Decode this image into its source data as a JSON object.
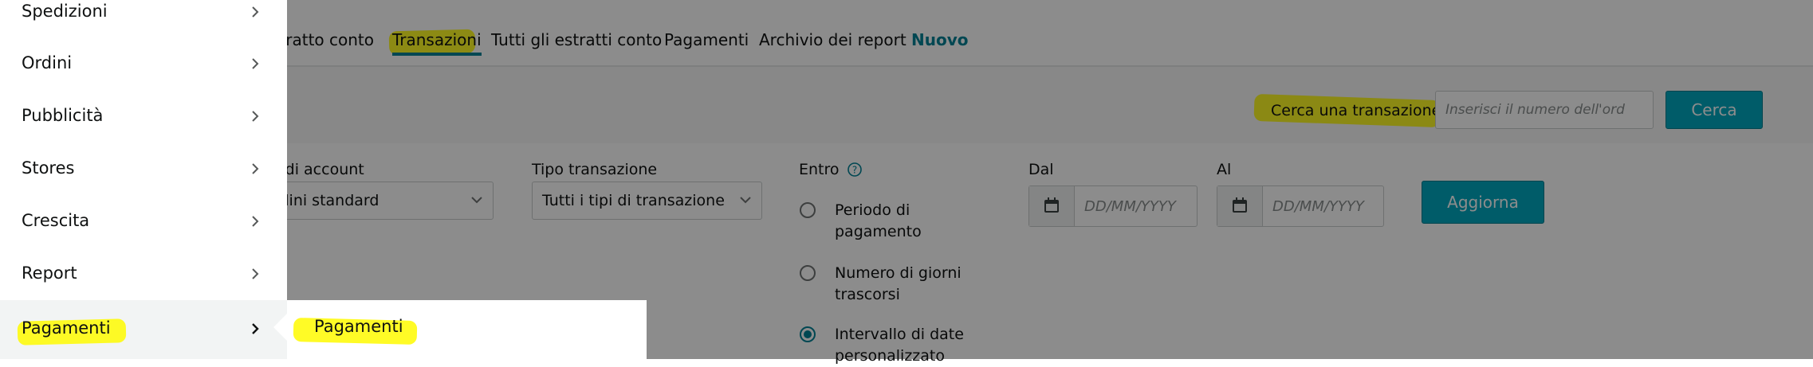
{
  "tabs": [
    {
      "label": "stratto conto"
    },
    {
      "label": "Transazioni"
    },
    {
      "label": "Tutti gli estratti conto"
    },
    {
      "label": "Pagamenti"
    },
    {
      "label": "Archivio dei report"
    }
  ],
  "tab_badge": "Nuovo",
  "search": {
    "label": "Cerca una transazione",
    "placeholder": "Inserisci il numero dell'ord",
    "button": "Cerca"
  },
  "filters": {
    "account_label": "o di account",
    "account_value": "rdini standard",
    "type_label": "Tipo transazione",
    "type_value": "Tutti i tipi di transazione",
    "within_label": "Entro",
    "radios": [
      {
        "label_lines": [
          "Periodo di",
          "pagamento"
        ],
        "checked": false
      },
      {
        "label_lines": [
          "Numero di giorni",
          "trascorsi"
        ],
        "checked": false
      },
      {
        "label_lines": [
          "Intervallo di date",
          "personalizzato"
        ],
        "checked": true
      }
    ],
    "from_label": "Dal",
    "to_label": "Al",
    "date_placeholder": "DD/MM/YYYY",
    "refresh_button": "Aggiorna"
  },
  "menu": {
    "items": [
      {
        "label": "Spedizioni"
      },
      {
        "label": "Ordini"
      },
      {
        "label": "Pubblicità"
      },
      {
        "label": "Stores"
      },
      {
        "label": "Crescita"
      },
      {
        "label": "Report"
      },
      {
        "label": "Pagamenti"
      }
    ],
    "submenu_label": "Pagamenti"
  },
  "colors": {
    "accent": "#008296",
    "button": "#00a8c0",
    "highlight": "#fff200"
  },
  "icons": {
    "menu_chevron": "chevron-right-icon",
    "select_chevron": "chevron-down-icon",
    "help": "help-circle-icon",
    "calendar": "calendar-icon"
  }
}
